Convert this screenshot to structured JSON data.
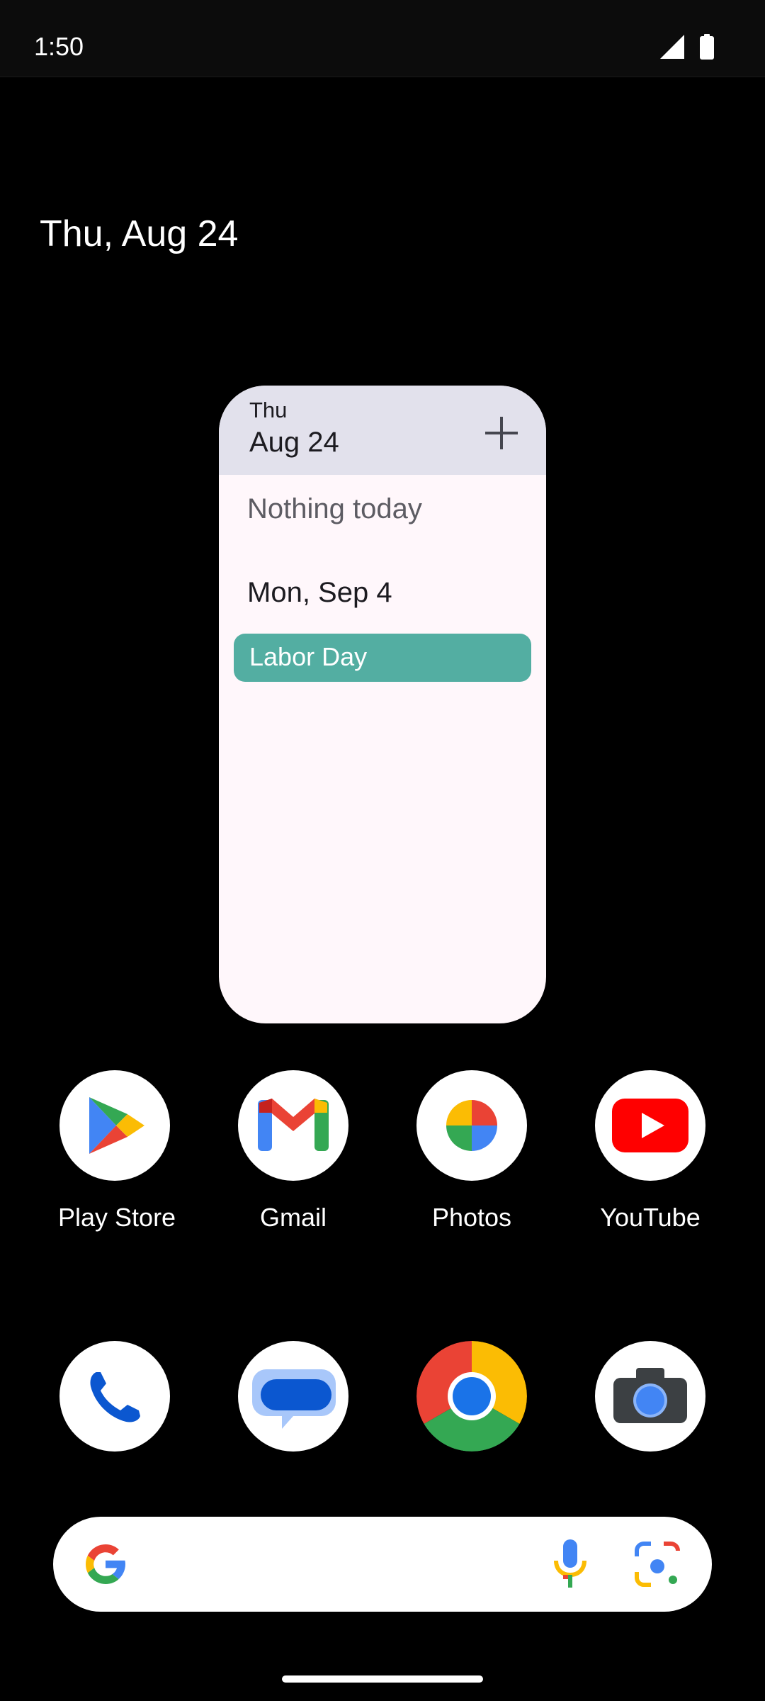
{
  "status_bar": {
    "time": "1:50",
    "icons": [
      "signal-icon",
      "battery-icon"
    ]
  },
  "home": {
    "date": "Thu, Aug 24"
  },
  "calendar_widget": {
    "header_day": "Thu",
    "header_date": "Aug 24",
    "add_icon": "plus-icon",
    "empty_text": "Nothing today",
    "upcoming_date": "Mon, Sep 4",
    "event": {
      "label": "Labor Day",
      "color": "#53aea2"
    }
  },
  "apps": [
    {
      "label": "Play Store",
      "icon": "play-store-icon"
    },
    {
      "label": "Gmail",
      "icon": "gmail-icon"
    },
    {
      "label": "Photos",
      "icon": "photos-icon"
    },
    {
      "label": "YouTube",
      "icon": "youtube-icon"
    }
  ],
  "dock": [
    {
      "icon": "phone-icon"
    },
    {
      "icon": "messages-icon"
    },
    {
      "icon": "chrome-icon"
    },
    {
      "icon": "camera-icon"
    }
  ],
  "search_bar": {
    "icons": [
      "google-g-icon",
      "microphone-icon",
      "lens-icon"
    ]
  }
}
